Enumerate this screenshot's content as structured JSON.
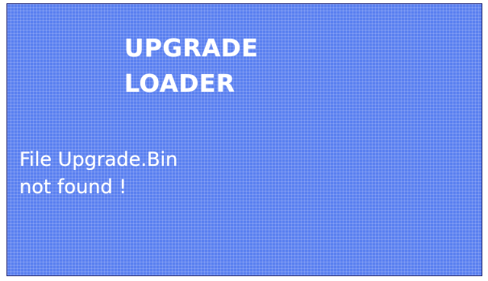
{
  "screen": {
    "background_color": "#5a80f0",
    "text_color": "#ffffff",
    "title_lines": [
      "UPGRADE",
      "LOADER"
    ],
    "message_lines": [
      "File Upgrade.Bin",
      "not found !"
    ]
  }
}
